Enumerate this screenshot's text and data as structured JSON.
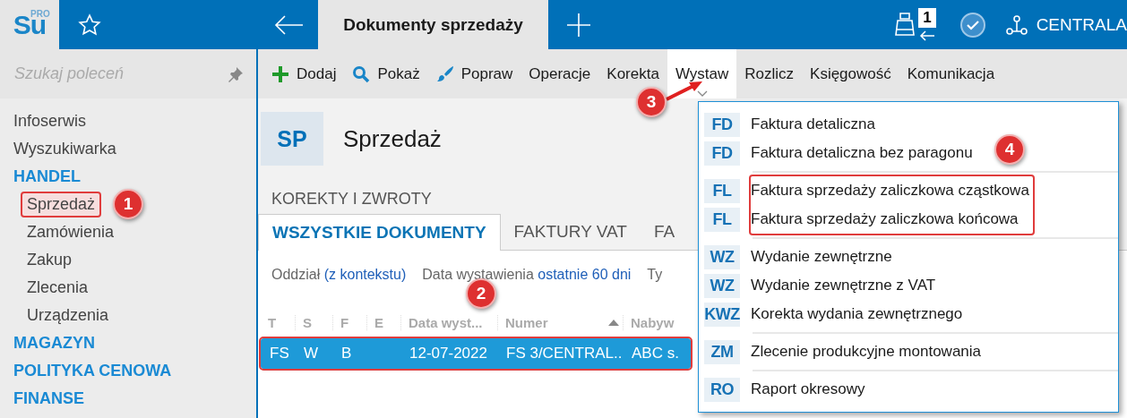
{
  "app": {
    "logo": "Su",
    "logo_sup": "PRO"
  },
  "header": {
    "tab": {
      "label": "Dokumenty sprzedaży",
      "selected": true
    },
    "queue_count": "1",
    "branch": "CENTRALA"
  },
  "sidebar": {
    "search": {
      "placeholder": "Szukaj poleceń"
    },
    "items": [
      {
        "label": "Infoserwis",
        "kind": "link",
        "annotated": false
      },
      {
        "label": "Wyszukiwarka",
        "kind": "link",
        "annotated": false
      },
      {
        "label": "HANDEL",
        "kind": "section",
        "annotated": false
      },
      {
        "label": "Sprzedaż",
        "kind": "sub",
        "annotated": true
      },
      {
        "label": "Zamówienia",
        "kind": "sub",
        "annotated": false
      },
      {
        "label": "Zakup",
        "kind": "sub",
        "annotated": false
      },
      {
        "label": "Zlecenia",
        "kind": "sub",
        "annotated": false
      },
      {
        "label": "Urządzenia",
        "kind": "sub",
        "annotated": false
      },
      {
        "label": "MAGAZYN",
        "kind": "section",
        "annotated": false
      },
      {
        "label": "POLITYKA CENOWA",
        "kind": "section",
        "annotated": false
      },
      {
        "label": "FINANSE",
        "kind": "section",
        "annotated": false
      }
    ]
  },
  "toolbar": [
    {
      "label": "Dodaj",
      "selected": false
    },
    {
      "label": "Pokaż",
      "selected": false
    },
    {
      "label": "Popraw",
      "selected": false
    },
    {
      "label": "Operacje",
      "selected": false
    },
    {
      "label": "Korekta",
      "selected": false
    },
    {
      "label": "Wystaw",
      "selected": true
    },
    {
      "label": "Rozlicz",
      "selected": false
    },
    {
      "label": "Księgowość",
      "selected": false
    },
    {
      "label": "Komunikacja",
      "selected": false
    }
  ],
  "page": {
    "badge": "SP",
    "title": "Sprzedaż",
    "section": "KOREKTY I ZWROTY",
    "tabs": [
      {
        "label": "WSZYSTKIE DOKUMENTY",
        "selected": true
      },
      {
        "label": "FAKTURY VAT",
        "selected": false
      },
      {
        "label": "FA",
        "selected": false
      }
    ],
    "filters": [
      {
        "label": "Oddział",
        "value": "(z kontekstu)"
      },
      {
        "label": "Data wystawienia",
        "value": "ostatnie 60 dni"
      },
      {
        "label": "Ty"
      }
    ]
  },
  "table": {
    "columns": [
      {
        "label": "T",
        "sorted": false
      },
      {
        "label": "S",
        "sorted": false
      },
      {
        "label": "F",
        "sorted": false
      },
      {
        "label": "E",
        "sorted": false
      },
      {
        "label": "Data wyst...",
        "sorted": false
      },
      {
        "label": "Numer",
        "sorted": true
      },
      {
        "label": "Nabyw",
        "sorted": false
      }
    ],
    "rows": [
      {
        "cells": [
          "FS",
          "W",
          "B",
          null,
          "12-07-2022",
          "FS 3/CENTRAL...",
          "ABC s."
        ],
        "selected": true,
        "annotated": true
      }
    ]
  },
  "menu": {
    "groups": [
      {
        "annotated": false,
        "items": [
          {
            "code": "FD",
            "label": "Faktura detaliczna"
          },
          {
            "code": "FD",
            "label": "Faktura detaliczna bez paragonu"
          }
        ]
      },
      {
        "annotated": true,
        "items": [
          {
            "code": "FL",
            "label": "Faktura sprzedaży zaliczkowa cząstkowa"
          },
          {
            "code": "FL",
            "label": "Faktura sprzedaży zaliczkowa końcowa"
          }
        ]
      },
      {
        "annotated": false,
        "items": [
          {
            "code": "WZ",
            "label": "Wydanie zewnętrzne"
          },
          {
            "code": "WZ",
            "label": "Wydanie zewnętrzne z VAT"
          },
          {
            "code": "KWZ",
            "label": "Korekta wydania zewnętrznego"
          }
        ]
      },
      {
        "annotated": false,
        "items": [
          {
            "code": "ZM",
            "label": "Zlecenie produkcyjne montowania"
          }
        ]
      },
      {
        "annotated": false,
        "items": [
          {
            "code": "RO",
            "label": "Raport okresowy"
          }
        ]
      }
    ]
  },
  "annotations": [
    {
      "label": "1",
      "arrow": false
    },
    {
      "label": "2",
      "arrow": false
    },
    {
      "label": "3",
      "arrow": true
    },
    {
      "label": "4",
      "arrow": false
    }
  ]
}
